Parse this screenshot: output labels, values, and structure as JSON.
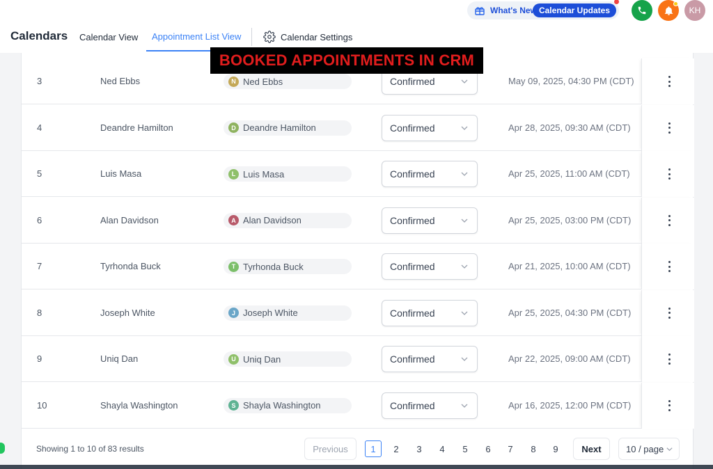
{
  "topbar": {
    "whats_new_label": "What's New",
    "calendar_updates_label": "Calendar Updates",
    "avatar_initials": "KH"
  },
  "tabsbar": {
    "title": "Calendars",
    "tabs": [
      {
        "label": "Calendar View"
      },
      {
        "label": "Appointment List View"
      },
      {
        "label": "Calendar Settings"
      }
    ]
  },
  "overlay_banner": "BOOKED APPOINTMENTS IN CRM",
  "rows": [
    {
      "num": "3",
      "name": "Ned Ebbs",
      "initial": "N",
      "initial_color": "#c4a857",
      "contact": "Ned Ebbs",
      "status": "Confirmed",
      "date": "May 09, 2025, 04:30 PM (CDT)"
    },
    {
      "num": "4",
      "name": "Deandre Hamilton",
      "initial": "D",
      "initial_color": "#8fb360",
      "contact": "Deandre Hamilton",
      "status": "Confirmed",
      "date": "Apr 28, 2025, 09:30 AM (CDT)"
    },
    {
      "num": "5",
      "name": "Luis Masa",
      "initial": "L",
      "initial_color": "#8fc06a",
      "contact": "Luis Masa",
      "status": "Confirmed",
      "date": "Apr 25, 2025, 11:00 AM (CDT)"
    },
    {
      "num": "6",
      "name": "Alan Davidson",
      "initial": "A",
      "initial_color": "#b85a6a",
      "contact": "Alan Davidson",
      "status": "Confirmed",
      "date": "Apr 25, 2025, 03:00 PM (CDT)"
    },
    {
      "num": "7",
      "name": "Tyrhonda Buck",
      "initial": "T",
      "initial_color": "#7cbf6a",
      "contact": "Tyrhonda Buck",
      "status": "Confirmed",
      "date": "Apr 21, 2025, 10:00 AM (CDT)"
    },
    {
      "num": "8",
      "name": "Joseph White",
      "initial": "J",
      "initial_color": "#6aa6c8",
      "contact": "Joseph White",
      "status": "Confirmed",
      "date": "Apr 25, 2025, 04:30 PM (CDT)"
    },
    {
      "num": "9",
      "name": "Uniq Dan",
      "initial": "U",
      "initial_color": "#8fc06a",
      "contact": "Uniq Dan",
      "status": "Confirmed",
      "date": "Apr 22, 2025, 09:00 AM (CDT)"
    },
    {
      "num": "10",
      "name": "Shayla Washington",
      "initial": "S",
      "initial_color": "#5fb393",
      "contact": "Shayla Washington",
      "status": "Confirmed",
      "date": "Apr 16, 2025, 12:00 PM (CDT)"
    }
  ],
  "footer": {
    "showing": "Showing 1 to 10 of 83 results",
    "previous_label": "Previous",
    "next_label": "Next",
    "pages": [
      "1",
      "2",
      "3",
      "4",
      "5",
      "6",
      "7",
      "8",
      "9"
    ],
    "active_page": "1",
    "per_page": "10 / page"
  },
  "colors": {
    "accent": "#3b82f6",
    "phone": "#16a34a",
    "bell": "#f97316",
    "banner_text": "#e11d1d"
  }
}
